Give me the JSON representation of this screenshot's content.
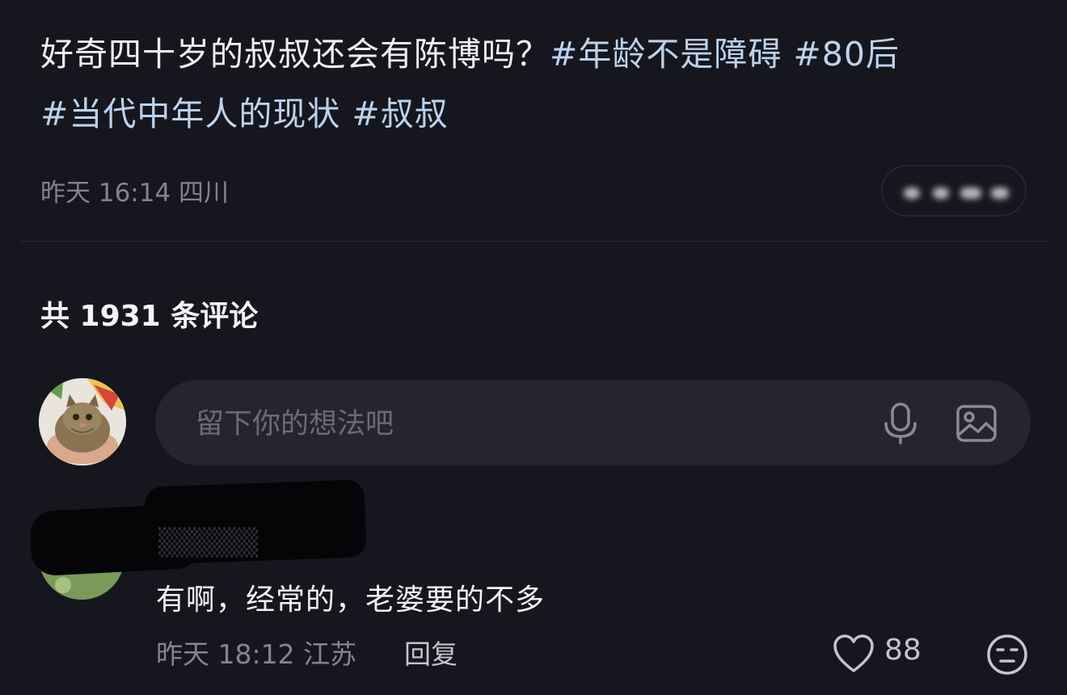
{
  "post": {
    "text": "好奇四十岁的叔叔还会有陈博吗？",
    "hashtags": [
      "#年龄不是障碍",
      "#80后",
      "#当代中年人的现状",
      "#叔叔"
    ],
    "meta": "昨天 16:14 四川"
  },
  "comments_section": {
    "count_label": "共 1931 条评论"
  },
  "compose": {
    "placeholder": "留下你的想法吧",
    "mic_icon": "microphone-icon",
    "image_icon": "image-icon"
  },
  "comment": {
    "text": "有啊，经常的，老婆要的不多",
    "meta": "昨天 18:12 江苏",
    "reply_label": "回复",
    "likes": "88",
    "like_icon": "heart-outline-icon",
    "emoji_icon": "emoji-face-icon"
  },
  "colors": {
    "background": "#16161e",
    "hashtag": "#bcd2ec",
    "input_bg": "#25252e",
    "meta_text": "#83838c"
  }
}
